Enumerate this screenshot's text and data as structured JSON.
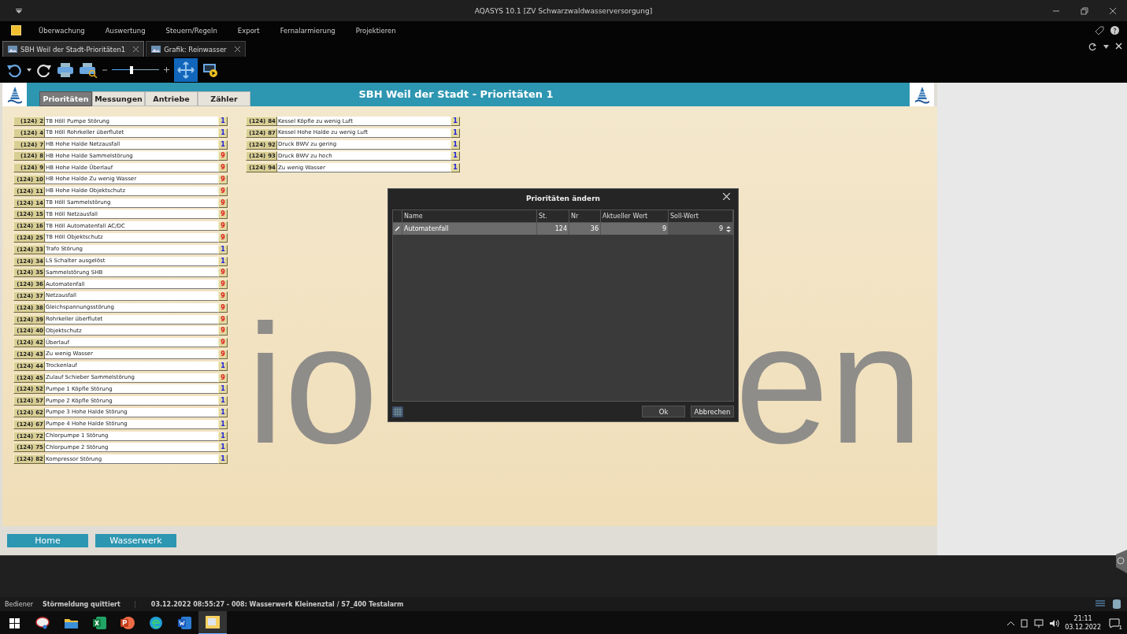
{
  "window": {
    "title": "AQASYS 10.1 [ZV Schwarzwaldwasserversorgung]"
  },
  "menu": [
    "Überwachung",
    "Auswertung",
    "Steuern/Regeln",
    "Export",
    "Fernalarmierung",
    "Projektieren"
  ],
  "doc_tabs": [
    {
      "label": "SBH Weil der Stadt-Prioritäten1",
      "selected": true
    },
    {
      "label": "Grafik: Reinwasser",
      "selected": false
    }
  ],
  "zoom_slider": {
    "level": 0.42
  },
  "page": {
    "title": "SBH Weil der Stadt - Prioritäten 1",
    "tabs": [
      {
        "label": "Prioritäten",
        "selected": true
      },
      {
        "label": "Messungen",
        "selected": false
      },
      {
        "label": "Antriebe",
        "selected": false
      },
      {
        "label": "Zähler",
        "selected": false
      }
    ],
    "watermark_parts": [
      "io",
      "en"
    ],
    "columns": [
      [
        {
          "station": "(124)",
          "nr": "2",
          "name": "TB Höll Pumpe Störung",
          "priority": "1",
          "kind": "low"
        },
        {
          "station": "(124)",
          "nr": "4",
          "name": "TB Höll Rohrkeller überflutet",
          "priority": "1",
          "kind": "low"
        },
        {
          "station": "(124)",
          "nr": "7",
          "name": "HB Hohe Halde Netzausfall",
          "priority": "1",
          "kind": "low"
        },
        {
          "station": "(124)",
          "nr": "8",
          "name": "HB Hohe Halde Sammelstörung",
          "priority": "9",
          "kind": "high"
        },
        {
          "station": "(124)",
          "nr": "9",
          "name": "HB Hohe Halde Überlauf",
          "priority": "9",
          "kind": "high"
        },
        {
          "station": "(124)",
          "nr": "10",
          "name": "HB Hohe Halde  Zu wenig Wasser",
          "priority": "9",
          "kind": "high"
        },
        {
          "station": "(124)",
          "nr": "11",
          "name": "HB Hohe Halde Objektschutz",
          "priority": "9",
          "kind": "high"
        },
        {
          "station": "(124)",
          "nr": "14",
          "name": "TB Höll Sammelstörung",
          "priority": "9",
          "kind": "high"
        },
        {
          "station": "(124)",
          "nr": "15",
          "name": "TB Höll Netzausfall",
          "priority": "9",
          "kind": "high"
        },
        {
          "station": "(124)",
          "nr": "16",
          "name": "TB Höll Automatenfall AC/DC",
          "priority": "9",
          "kind": "high"
        },
        {
          "station": "(124)",
          "nr": "25",
          "name": "TB Höll Objektschutz",
          "priority": "9",
          "kind": "high"
        },
        {
          "station": "(124)",
          "nr": "33",
          "name": "Trafo Störung",
          "priority": "1",
          "kind": "low"
        },
        {
          "station": "(124)",
          "nr": "34",
          "name": "LS Schalter ausgelöst",
          "priority": "1",
          "kind": "low"
        },
        {
          "station": "(124)",
          "nr": "35",
          "name": "Sammelstörung SHB",
          "priority": "9",
          "kind": "high"
        },
        {
          "station": "(124)",
          "nr": "36",
          "name": "Automatenfall",
          "priority": "9",
          "kind": "high"
        },
        {
          "station": "(124)",
          "nr": "37",
          "name": "Netzausfall",
          "priority": "9",
          "kind": "high"
        },
        {
          "station": "(124)",
          "nr": "38",
          "name": "Gleichspannungsstörung",
          "priority": "9",
          "kind": "high"
        },
        {
          "station": "(124)",
          "nr": "39",
          "name": "Rohrkeller überflutet",
          "priority": "9",
          "kind": "high"
        },
        {
          "station": "(124)",
          "nr": "40",
          "name": "Objektschutz",
          "priority": "9",
          "kind": "high"
        },
        {
          "station": "(124)",
          "nr": "42",
          "name": "Überlauf",
          "priority": "9",
          "kind": "high"
        },
        {
          "station": "(124)",
          "nr": "43",
          "name": "Zu wenig Wasser",
          "priority": "9",
          "kind": "high"
        },
        {
          "station": "(124)",
          "nr": "44",
          "name": "Trockenlauf",
          "priority": "1",
          "kind": "low"
        },
        {
          "station": "(124)",
          "nr": "45",
          "name": "Zulauf Schieber Sammelstörung",
          "priority": "9",
          "kind": "high"
        },
        {
          "station": "(124)",
          "nr": "52",
          "name": "Pumpe 1 Köpfle Störung",
          "priority": "1",
          "kind": "low"
        },
        {
          "station": "(124)",
          "nr": "57",
          "name": "Pumpe 2 Köpfle Störung",
          "priority": "1",
          "kind": "low"
        },
        {
          "station": "(124)",
          "nr": "62",
          "name": "Pumpe 3 Hohe Halde Störung",
          "priority": "1",
          "kind": "low"
        },
        {
          "station": "(124)",
          "nr": "67",
          "name": "Pumpe 4 Hohe Halde Störung",
          "priority": "1",
          "kind": "low"
        },
        {
          "station": "(124)",
          "nr": "72",
          "name": "Chlorpumpe 1 Störung",
          "priority": "1",
          "kind": "low"
        },
        {
          "station": "(124)",
          "nr": "75",
          "name": "Chlorpumpe 2 Störung",
          "priority": "1",
          "kind": "low"
        },
        {
          "station": "(124)",
          "nr": "82",
          "name": "Kompressor Störung",
          "priority": "1",
          "kind": "low"
        }
      ],
      [
        {
          "station": "(124)",
          "nr": "84",
          "name": "Kessel Köpfle zu wenig Luft",
          "priority": "1",
          "kind": "low"
        },
        {
          "station": "(124)",
          "nr": "87",
          "name": "Kessel Hohe Halde zu wenig Luft",
          "priority": "1",
          "kind": "low"
        },
        {
          "station": "(124)",
          "nr": "92",
          "name": "Druck BWV zu gering",
          "priority": "1",
          "kind": "low"
        },
        {
          "station": "(124)",
          "nr": "93",
          "name": "Druck BWV zu hoch",
          "priority": "1",
          "kind": "low"
        },
        {
          "station": "(124)",
          "nr": "94",
          "name": "Zu wenig Wasser",
          "priority": "1",
          "kind": "low"
        }
      ]
    ],
    "nav_buttons": [
      "Home",
      "Wasserwerk"
    ]
  },
  "dialog": {
    "title": "Prioritäten ändern",
    "columns": [
      "Name",
      "St.",
      "Nr",
      "Aktueller Wert",
      "Soll-Wert"
    ],
    "rows": [
      {
        "name": "Automatenfall",
        "st": "124",
        "nr": "36",
        "current": "9",
        "target": "9",
        "selected": true
      }
    ],
    "buttons": [
      "Ok",
      "Abbrechen"
    ]
  },
  "status_bar": {
    "user_label": "Bediener",
    "event": "Störmeldung quittiert",
    "message": "03.12.2022 08:55:27 - 008:  Wasserwerk Kleinenztal / S7_400 Testalarm"
  },
  "taskbar": {
    "time": "21:11",
    "date": "03.12.2022",
    "notifications": "1"
  }
}
